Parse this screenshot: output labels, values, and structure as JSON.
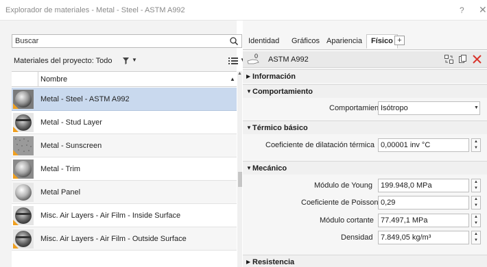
{
  "window": {
    "title": "Explorador de materiales - Metal - Steel - ASTM A992",
    "help": "?",
    "close": "✕"
  },
  "left": {
    "search_placeholder": "Buscar",
    "filter_label": "Materiales del proyecto: Todo",
    "column_header": "Nombre",
    "rows": [
      {
        "name": "Metal - Steel - ASTM A992",
        "selected": true,
        "thumb": "sphere-steel-icon"
      },
      {
        "name": "Metal - Stud Layer",
        "selected": false,
        "thumb": "stud-layer-icon"
      },
      {
        "name": "Metal - Sunscreen",
        "selected": false,
        "thumb": "sunscreen-icon"
      },
      {
        "name": "Metal - Trim",
        "selected": false,
        "thumb": "sphere-trim-icon"
      },
      {
        "name": "Metal Panel",
        "selected": false,
        "thumb": "sphere-panel-icon"
      },
      {
        "name": "Misc. Air Layers - Air Film - Inside Surface",
        "selected": false,
        "thumb": "air-film-icon"
      },
      {
        "name": "Misc. Air Layers - Air Film - Outside Surface",
        "selected": false,
        "thumb": "air-film-icon"
      }
    ]
  },
  "right": {
    "tabs": [
      "Identidad",
      "Gráficos",
      "Apariencia",
      "Físico"
    ],
    "active_tab": "Físico",
    "add_tab": "+",
    "asset_name": "ASTM A992",
    "asset_version": "0",
    "sections": {
      "informacion": "Información",
      "comportamiento": "Comportamiento",
      "termico": "Térmico básico",
      "mecanico": "Mecánico",
      "resistencia": "Resistencia"
    },
    "props": {
      "comportamiento_label": "Comportamiento",
      "comportamiento_value": "Isótropo",
      "dilatacion_label": "Coeficiente de dilatación térmica",
      "dilatacion_value": "0,00001 inv °C",
      "young_label": "Módulo de Young",
      "young_value": "199.948,0 MPa",
      "poisson_label": "Coeficiente de Poisson",
      "poisson_value": "0,29",
      "cortante_label": "Módulo cortante",
      "cortante_value": "77.497,1 MPa",
      "densidad_label": "Densidad",
      "densidad_value": "7.849,05 kg/m³"
    }
  },
  "colors": {
    "selection": "#c9d9ee",
    "accent_orange": "#f0a020",
    "close_red": "#d9332b"
  }
}
